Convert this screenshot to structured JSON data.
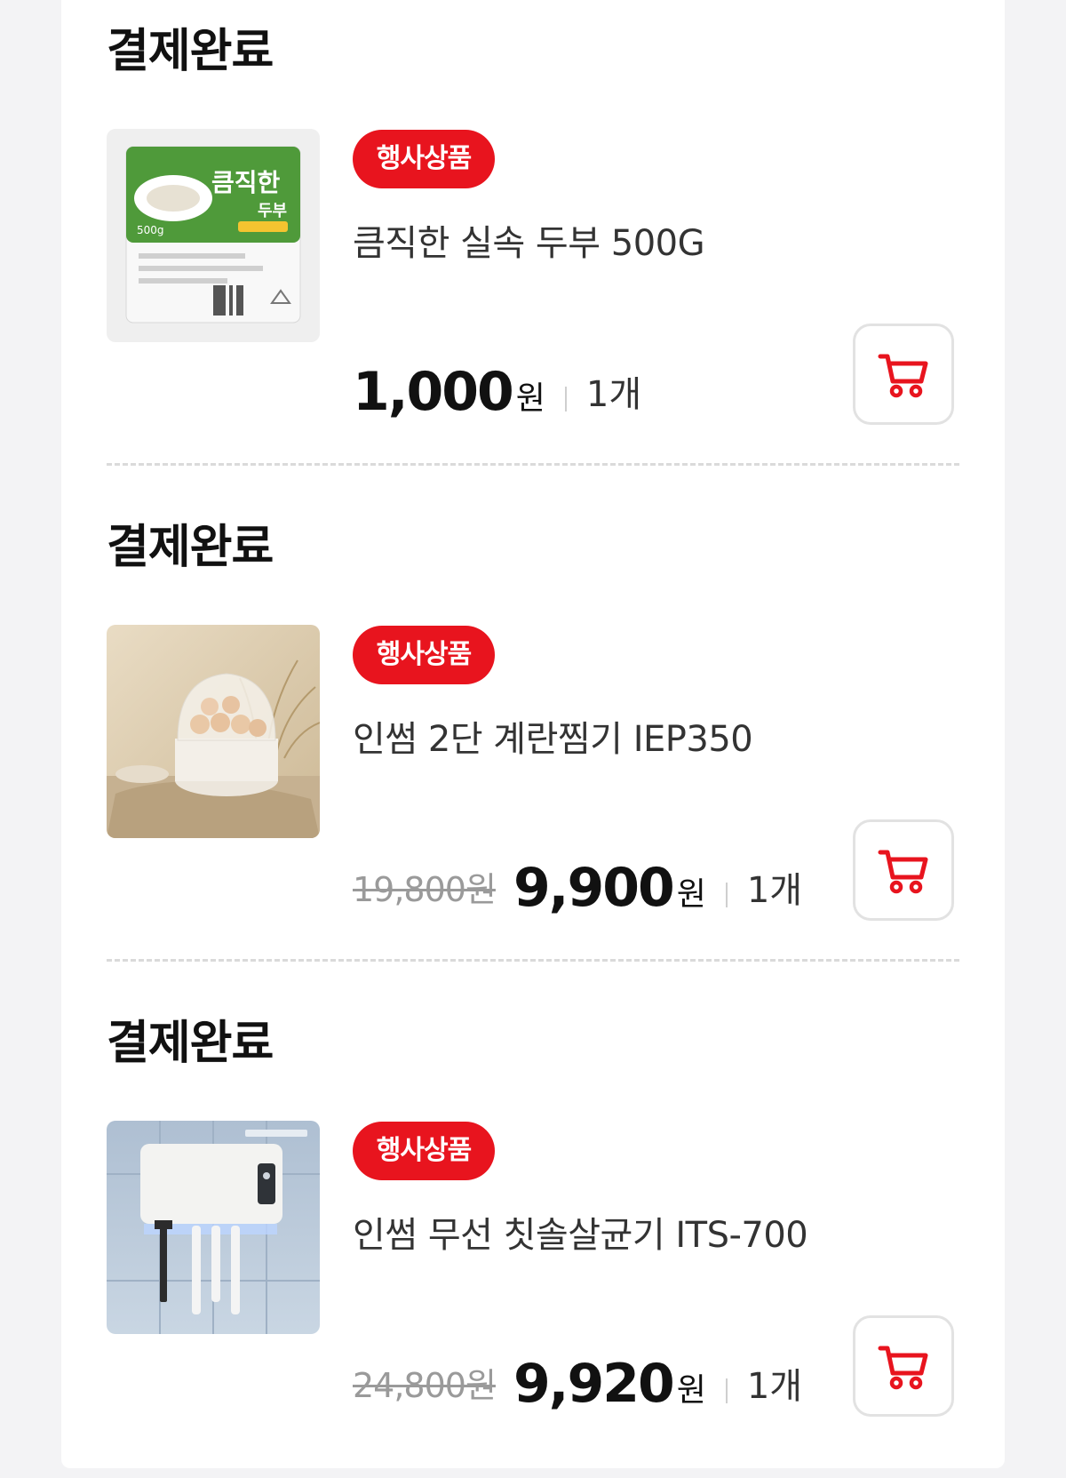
{
  "orders": [
    {
      "status": "결제완료",
      "badge": "행사상품",
      "name": "큼직한 실속 두부 500G",
      "original_price": "",
      "price": "1,000",
      "currency": "원",
      "quantity": "1개",
      "package_text": "큼직한",
      "package_sub": "두부",
      "package_weight": "500g"
    },
    {
      "status": "결제완료",
      "badge": "행사상품",
      "name": "인썸 2단 계란찜기 IEP350",
      "original_price": "19,800원",
      "price": "9,900",
      "currency": "원",
      "quantity": "1개"
    },
    {
      "status": "결제완료",
      "badge": "행사상품",
      "name": "인썸 무선 칫솔살균기 ITS-700",
      "original_price": "24,800원",
      "price": "9,920",
      "currency": "원",
      "quantity": "1개"
    }
  ],
  "icons": {
    "cart": "cart-icon"
  },
  "colors": {
    "accent": "#e8141e",
    "background": "#f3f3f5",
    "card": "#ffffff"
  }
}
